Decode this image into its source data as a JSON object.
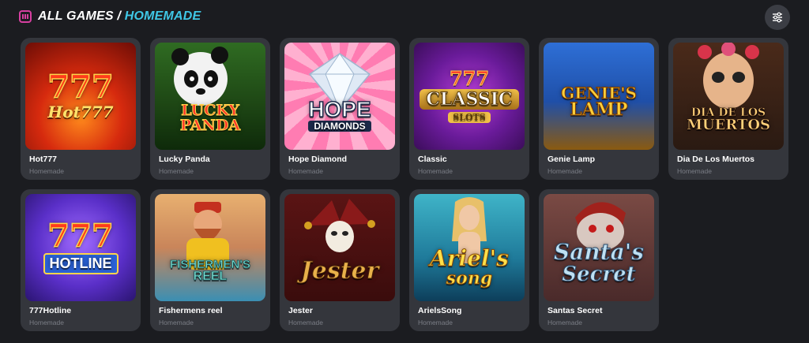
{
  "header": {
    "icon": "slot-machine-icon",
    "title_part1": "ALL GAMES /",
    "title_part2": "HOMEMADE"
  },
  "filter_button": {
    "icon": "filter-sliders-icon"
  },
  "games": [
    {
      "name": "Hot777",
      "category": "Homemade",
      "art_line1": "777",
      "art_line2": "Hot777"
    },
    {
      "name": "Lucky Panda",
      "category": "Homemade",
      "art_line1": "LUCKY",
      "art_line2": "PANDA"
    },
    {
      "name": "Hope Diamond",
      "category": "Homemade",
      "art_line1": "HOPE",
      "art_line2": "DIAMONDS"
    },
    {
      "name": "Classic",
      "category": "Homemade",
      "art_line1": "777",
      "art_line2": "CLASSIC",
      "art_line3": "SLOTS"
    },
    {
      "name": "Genie Lamp",
      "category": "Homemade",
      "art_line1": "GENIE'S",
      "art_line2": "LAMP"
    },
    {
      "name": "Dia De Los Muertos",
      "category": "Homemade",
      "art_line1": "DIA DE LOS",
      "art_line2": "MUERTOS"
    },
    {
      "name": "777Hotline",
      "category": "Homemade",
      "art_line1": "777",
      "art_line2": "HOTLINE"
    },
    {
      "name": "Fishermens reel",
      "category": "Homemade",
      "art_line1": "FISHERMEN'S",
      "art_line2": "REEL"
    },
    {
      "name": "Jester",
      "category": "Homemade",
      "art_line1": "Jester"
    },
    {
      "name": "ArielsSong",
      "category": "Homemade",
      "art_line1": "Ariel's",
      "art_line2": "song"
    },
    {
      "name": "Santas Secret",
      "category": "Homemade",
      "art_line1": "Santa's",
      "art_line2": "Secret"
    }
  ],
  "colors": {
    "background": "#1b1c20",
    "card": "#34363c",
    "accent_pink": "#d63fa0",
    "accent_cyan": "#3fc7e6",
    "muted_text": "#7b7e86"
  }
}
